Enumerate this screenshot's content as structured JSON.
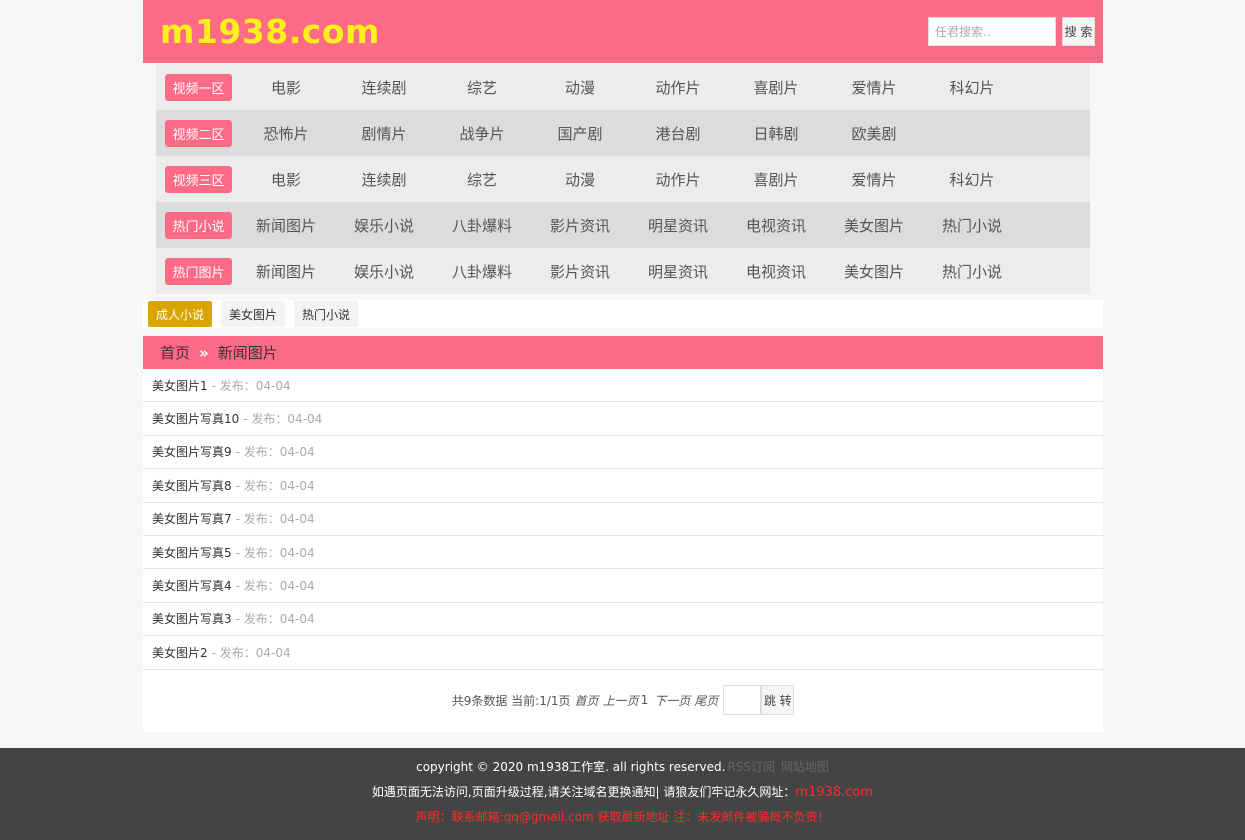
{
  "header": {
    "logo": "m1938.com",
    "search_placeholder": "任君搜索..",
    "search_label": "搜 索"
  },
  "nav": [
    {
      "badge": "视频一区",
      "items": [
        "电影",
        "连续剧",
        "综艺",
        "动漫",
        "动作片",
        "喜剧片",
        "爱情片",
        "科幻片"
      ]
    },
    {
      "badge": "视频二区",
      "items": [
        "恐怖片",
        "剧情片",
        "战争片",
        "国产剧",
        "港台剧",
        "日韩剧",
        "欧美剧"
      ]
    },
    {
      "badge": "视频三区",
      "items": [
        "电影",
        "连续剧",
        "综艺",
        "动漫",
        "动作片",
        "喜剧片",
        "爱情片",
        "科幻片"
      ]
    },
    {
      "badge": "热门小说",
      "items": [
        "新闻图片",
        "娱乐小说",
        "八卦爆料",
        "影片资讯",
        "明星资讯",
        "电视资讯",
        "美女图片",
        "热门小说"
      ]
    },
    {
      "badge": "热门图片",
      "items": [
        "新闻图片",
        "娱乐小说",
        "八卦爆料",
        "影片资讯",
        "明星资讯",
        "电视资讯",
        "美女图片",
        "热门小说"
      ]
    }
  ],
  "tags": [
    "成人小说",
    "美女图片",
    "热门小说"
  ],
  "breadcrumb": {
    "home": "首页",
    "sep": "»",
    "current": "新闻图片"
  },
  "list": [
    {
      "title": "美女图片1",
      "date": "- 发布：04-04"
    },
    {
      "title": "美女图片写真10",
      "date": "- 发布：04-04"
    },
    {
      "title": "美女图片写真9",
      "date": "- 发布：04-04"
    },
    {
      "title": "美女图片写真8",
      "date": "- 发布：04-04"
    },
    {
      "title": "美女图片写真7",
      "date": "- 发布：04-04"
    },
    {
      "title": "美女图片写真5",
      "date": "- 发布：04-04"
    },
    {
      "title": "美女图片写真4",
      "date": "- 发布：04-04"
    },
    {
      "title": "美女图片写真3",
      "date": "- 发布：04-04"
    },
    {
      "title": "美女图片2",
      "date": "- 发布：04-04"
    }
  ],
  "pager": {
    "summary": "共9条数据 当前:1/1页",
    "first": "首页",
    "prev": "上一页",
    "page": "1",
    "next": "下一页",
    "last": "尾页",
    "jump": "跳 转"
  },
  "footer": {
    "copyright": "copyright © 2020 m1938工作室. all rights reserved.",
    "rss": "RSS订阅",
    "sitemap": "网站地图",
    "notice": "如遇页面无法访问,页面升级过程,请关注域名更换通知| 请狼友们牢记永久网址：",
    "site": "m1938.com",
    "statement": "声明：联系邮箱:qq@gmail.com 获取最新地址 注：未发邮件被骗概不负责！"
  },
  "colors": {
    "brand": "#ff6b86",
    "logo": "#ffef1a",
    "tag_active": "#d9a400",
    "footer_bg": "#444444",
    "warning": "#ff2a2a"
  }
}
